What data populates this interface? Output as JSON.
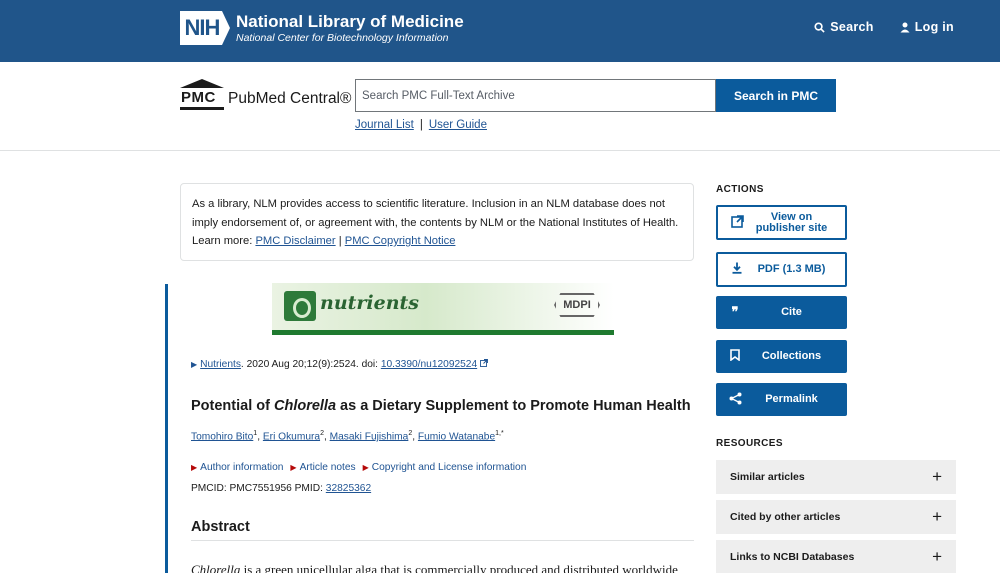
{
  "nih": {
    "badge": "NIH",
    "title": "National Library of Medicine",
    "subtitle": "National Center for Biotechnology Information",
    "search_label": "Search",
    "login_label": "Log in"
  },
  "pmc": {
    "logo_letters": "PMC",
    "name": "PubMed Central®",
    "search_placeholder": "Search PMC Full-Text Archive",
    "search_button": "Search in PMC",
    "journal_list": "Journal List",
    "separator": "|",
    "user_guide": "User Guide"
  },
  "disclaimer": {
    "text": "As a library, NLM provides access to scientific literature. Inclusion in an NLM database does not imply endorsement of, or agreement with, the contents by NLM or the National Institutes of Health.",
    "learn_more": "Learn more:",
    "link1": "PMC Disclaimer",
    "sep": "|",
    "link2": "PMC Copyright Notice"
  },
  "journal_banner": {
    "name": "nutrients",
    "publisher": "MDPI"
  },
  "article": {
    "journal_link": "Nutrients",
    "citation": ". 2020 Aug 20;12(9):2524. doi: ",
    "doi": "10.3390/nu12092524",
    "title_pre": "Potential of ",
    "title_italic": "Chlorella",
    "title_post": " as a Dietary Supplement to Promote Human Health",
    "authors": [
      {
        "name": "Tomohiro Bito",
        "sup": "1"
      },
      {
        "name": "Eri Okumura",
        "sup": "2"
      },
      {
        "name": "Masaki Fujishima",
        "sup": "2"
      },
      {
        "name": "Fumio Watanabe",
        "sup": "1,*"
      }
    ],
    "meta_links": [
      "Author information",
      "Article notes",
      "Copyright and License information"
    ],
    "pmcid": "PMCID: PMC7551956",
    "pmid_label": "PMID:",
    "pmid": "32825362",
    "abstract_heading": "Abstract",
    "abstract_italic": "Chlorella",
    "abstract_rest": " is a green unicellular alga that is commercially produced and distributed worldwide"
  },
  "sidebar": {
    "actions_heading": "ACTIONS",
    "actions": [
      {
        "label": "View on publisher site",
        "icon": "external-link-icon"
      },
      {
        "label": "PDF (1.3 MB)",
        "icon": "download-icon"
      },
      {
        "label": "Cite",
        "icon": "quote-icon"
      },
      {
        "label": "Collections",
        "icon": "bookmark-icon"
      },
      {
        "label": "Permalink",
        "icon": "share-icon"
      }
    ],
    "resources_heading": "RESOURCES",
    "resources": [
      "Similar articles",
      "Cited by other articles",
      "Links to NCBI Databases"
    ]
  }
}
